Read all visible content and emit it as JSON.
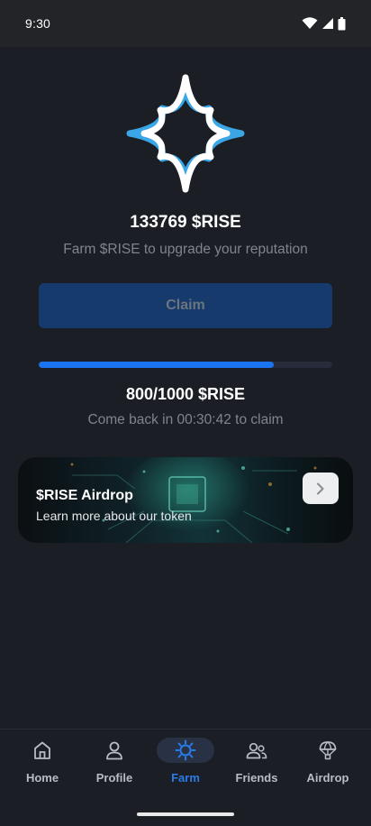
{
  "status_bar": {
    "time": "9:30",
    "icons": [
      "wifi-icon",
      "cell-signal-icon",
      "battery-icon"
    ]
  },
  "farm": {
    "balance": "133769 $RISE",
    "subtitle": "Farm $RISE to upgrade your reputation",
    "claim_label": "Claim",
    "progress_text": "800/1000 $RISE",
    "progress_fraction": 0.8,
    "cooldown_text": "Come back in 00:30:42 to claim"
  },
  "airdrop_card": {
    "title": "$RISE Airdrop",
    "description": "Learn more about our token",
    "arrow_icon": "chevron-right-icon"
  },
  "bottom_nav": {
    "items": [
      {
        "label": "Home",
        "icon": "home-icon"
      },
      {
        "label": "Profile",
        "icon": "user-icon"
      },
      {
        "label": "Farm",
        "icon": "sun-icon",
        "active": true
      },
      {
        "label": "Friends",
        "icon": "friends-icon"
      },
      {
        "label": "Airdrop",
        "icon": "parachute-icon"
      }
    ]
  },
  "colors": {
    "background": "#1b1e24",
    "accent": "#1a73f0",
    "logo_blue": "#3aa6e6",
    "claim_disabled": "#153a6b",
    "muted_text": "#80848c"
  }
}
